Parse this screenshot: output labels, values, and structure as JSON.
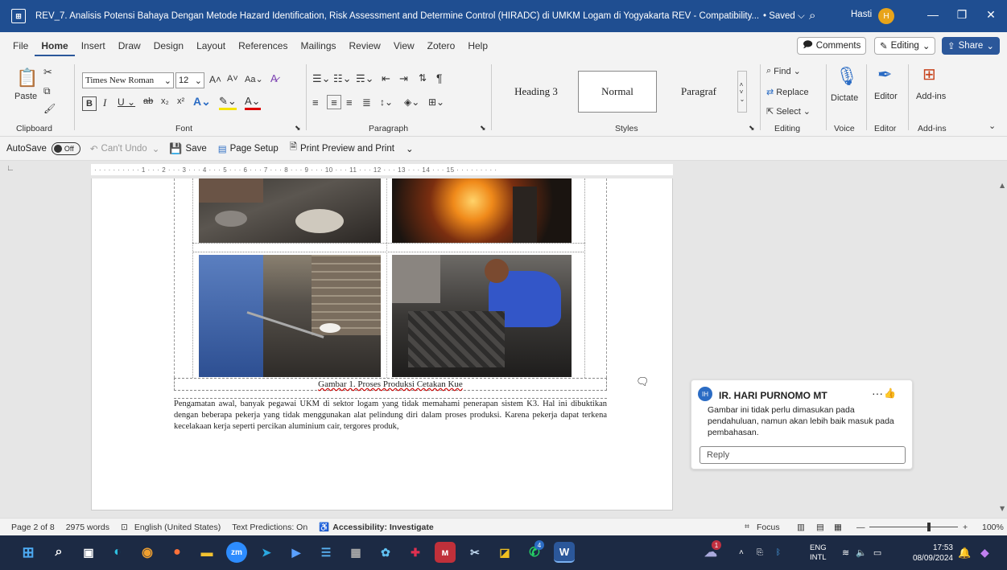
{
  "window": {
    "doc_title": "REV_7. Analisis Potensi Bahaya Dengan Metode Hazard Identification, Risk Assessment and Determine Control (HIRADC) di UMKM Logam di Yogyakarta REV  -  Compatibility...",
    "save_status": "• Saved ⌵",
    "user_name": "Hasti",
    "user_initial": "H"
  },
  "menu": {
    "tabs": [
      "File",
      "Home",
      "Insert",
      "Draw",
      "Design",
      "Layout",
      "References",
      "Mailings",
      "Review",
      "View",
      "Zotero",
      "Help"
    ],
    "comments_label": "Comments",
    "editing_label": "Editing",
    "share_label": "Share"
  },
  "ribbon": {
    "clipboard": {
      "paste": "Paste",
      "label": "Clipboard"
    },
    "font": {
      "family": "Times New Roman",
      "size": "12",
      "label": "Font"
    },
    "paragraph": {
      "label": "Paragraph"
    },
    "styles": {
      "items": [
        "Heading 3",
        "Normal",
        "Paragraf"
      ],
      "label": "Styles"
    },
    "editing": {
      "find": "Find",
      "replace": "Replace",
      "select": "Select",
      "label": "Editing"
    },
    "voice": {
      "dictate": "Dictate",
      "label": "Voice"
    },
    "editor": {
      "editor": "Editor",
      "label": "Editor"
    },
    "addins": {
      "addins": "Add-ins",
      "label": "Add-ins"
    }
  },
  "qat": {
    "autosave": "AutoSave",
    "autosave_state": "Off",
    "undo": "Can't Undo",
    "save": "Save",
    "page_setup": "Page Setup",
    "print_preview": "Print Preview and Print"
  },
  "ruler": {
    "text": "· · · · · · · · · · 1 · · · 2 · · · 3 · · · 4 · · · 5 · · · 6 · · · 7 · · · 8 · · · 9 · · · 10 · · · 11 · · · 12 · · · 13 · · · 14 · · · 15 · · · · · · · · ·"
  },
  "document": {
    "caption": "Gambar 1. Proses Produksi Cetakan Kue",
    "paragraph": "Pengamatan awal, banyak pegawai UKM di sektor logam yang tidak memahami penerapan sistem K3. Hal ini dibuktikan dengan beberapa pekerja yang tidak menggunakan alat pelindung diri dalam proses produksi. Karena pekerja dapat terkena kecelakaan kerja seperti percikan aluminium cair, tergores produk,"
  },
  "comment": {
    "author_initials": "IH",
    "author": "IR. HARI PURNOMO MT",
    "text": "Gambar ini tidak perlu dimasukan pada pendahuluan, namun akan lebih baik masuk pada pembahasan.",
    "reply_placeholder": "Reply"
  },
  "status": {
    "page": "Page 2 of 8",
    "words": "2975 words",
    "language": "English (United States)",
    "predictions": "Text Predictions: On",
    "accessibility": "Accessibility: Investigate",
    "focus": "Focus",
    "zoom": "100%"
  },
  "taskbar": {
    "lang": "ENG",
    "layout": "INTL",
    "time": "17:53",
    "date": "08/09/2024",
    "badge_chat": "4",
    "badge_weather": "1"
  },
  "colors": {
    "titlebar": "#1f4e91",
    "accent": "#2b579a",
    "taskbar": "#1c2a44"
  }
}
